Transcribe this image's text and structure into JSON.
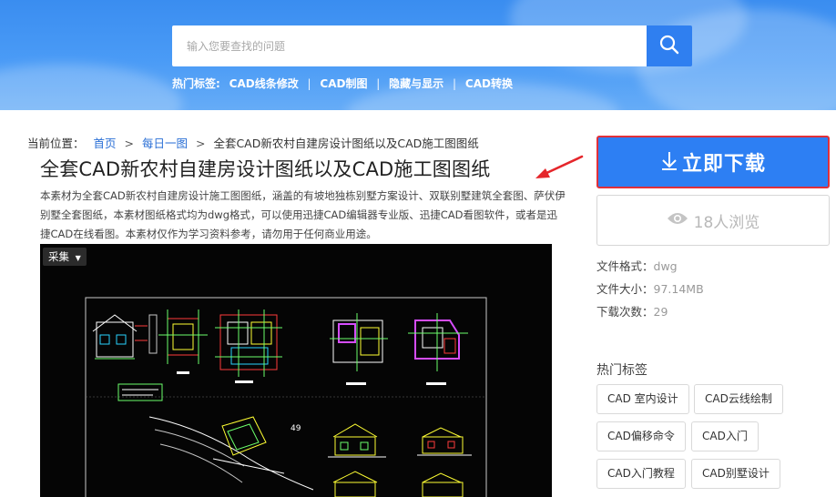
{
  "search": {
    "placeholder": "输入您要查找的问题"
  },
  "hot_tags": {
    "label": "热门标签:",
    "items": [
      "CAD线条修改",
      "CAD制图",
      "隐藏与显示",
      "CAD转换"
    ],
    "separator": "|"
  },
  "breadcrumb": {
    "prefix": "当前位置：",
    "items": [
      "首页",
      "每日一图",
      "全套CAD新农村自建房设计图纸以及CAD施工图图纸"
    ],
    "separator": ">"
  },
  "page_title": "全套CAD新农村自建房设计图纸以及CAD施工图图纸",
  "description": "本素材为全套CAD新农村自建房设计施工图图纸，涵盖的有坡地独栋别墅方案设计、双联别墅建筑全套图、萨伏伊别墅全套图纸，本素材图纸格式均为dwg格式，可以使用迅捷CAD编辑器专业版、迅捷CAD看图软件，或者是迅捷CAD在线看图。本素材仅作为学习资料参考，请勿用于任何商业用途。",
  "preview": {
    "collect_label": "采集",
    "sheet_number": "49"
  },
  "sidebar": {
    "download_label": "立即下载",
    "views_label": "18人浏览",
    "file_format_label": "文件格式：",
    "file_format_value": "dwg",
    "file_size_label": "文件大小：",
    "file_size_value": "97.14MB",
    "download_count_label": "下载次数：",
    "download_count_value": "29",
    "tags_title": "热门标签",
    "tags": [
      "CAD 室内设计",
      "CAD云线绘制",
      "CAD偏移命令",
      "CAD入门",
      "CAD入门教程",
      "CAD别墅设计"
    ]
  },
  "colors": {
    "banner_blue": "#3a8df0",
    "accent_blue": "#2d7ff3",
    "link_blue": "#2a6fd6",
    "highlight_red": "#e0303a"
  }
}
